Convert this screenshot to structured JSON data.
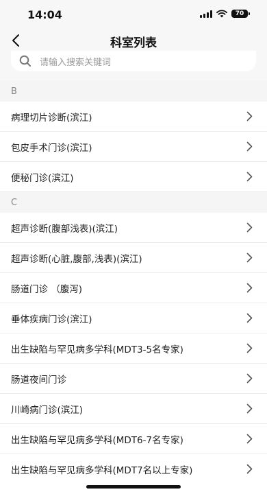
{
  "status": {
    "time": "14:04",
    "battery": "70"
  },
  "nav": {
    "title": "科室列表"
  },
  "search": {
    "placeholder": "请输入搜索关键词"
  },
  "sections": [
    {
      "letter": "B",
      "items": [
        "病理切片诊断(滨江)",
        "包皮手术门诊(滨江)",
        "便秘门诊(滨江)"
      ]
    },
    {
      "letter": "C",
      "items": [
        "超声诊断(腹部浅表)(滨江)",
        "超声诊断(心脏,腹部,浅表)(滨江)",
        "肠道门诊 （腹泻)",
        "垂体疾病门诊(滨江)",
        "出生缺陷与罕见病多学科(MDT3-5名专家)",
        "肠道夜间门诊",
        "川崎病门诊(滨江)",
        "出生缺陷与罕见病多学科(MDT6-7名专家)",
        "出生缺陷与罕见病多学科(MDT7名以上专家)"
      ]
    }
  ]
}
